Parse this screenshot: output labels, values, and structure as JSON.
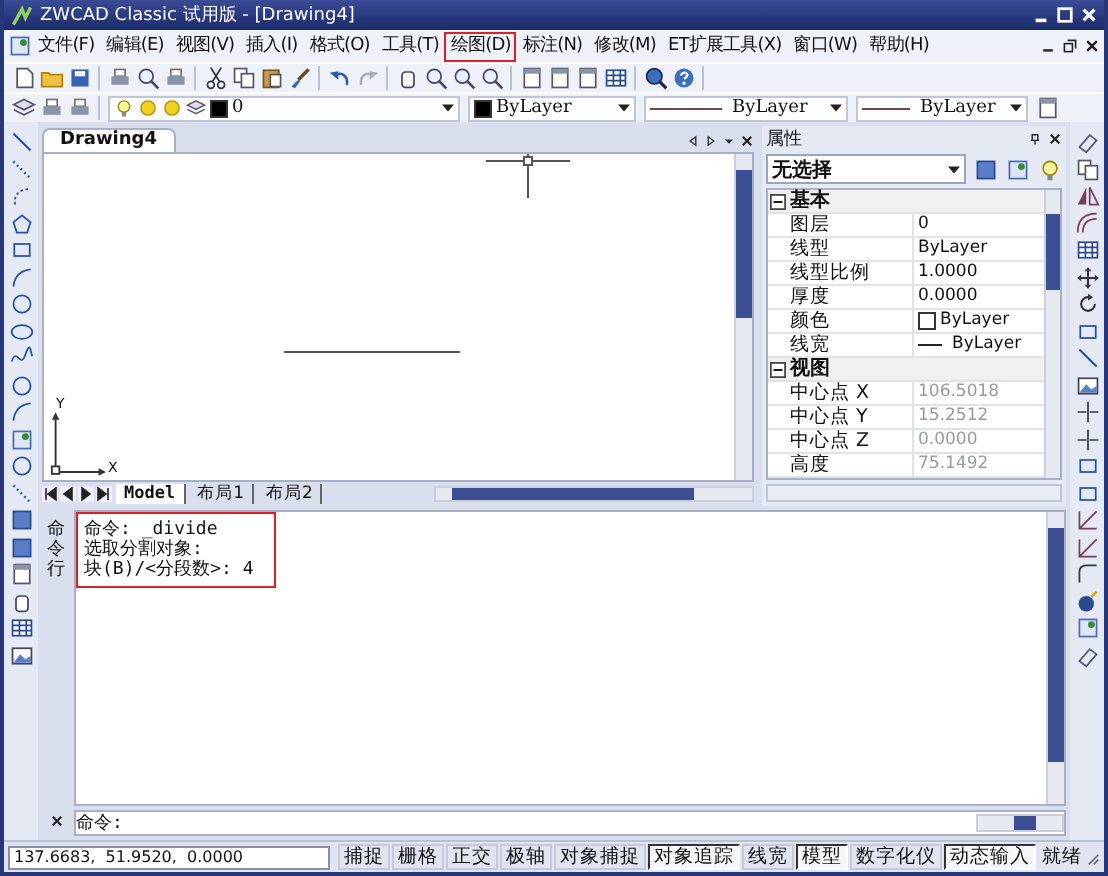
{
  "window": {
    "title": "ZWCAD Classic 试用版 - [Drawing4]"
  },
  "menu": [
    {
      "label": "文件(F)",
      "highlighted": false
    },
    {
      "label": "编辑(E)",
      "highlighted": false
    },
    {
      "label": "视图(V)",
      "highlighted": false
    },
    {
      "label": "插入(I)",
      "highlighted": false
    },
    {
      "label": "格式(O)",
      "highlighted": false
    },
    {
      "label": "工具(T)",
      "highlighted": false
    },
    {
      "label": "绘图(D)",
      "highlighted": true
    },
    {
      "label": "标注(N)",
      "highlighted": false
    },
    {
      "label": "修改(M)",
      "highlighted": false
    },
    {
      "label": "ET扩展工具(X)",
      "highlighted": false
    },
    {
      "label": "窗口(W)",
      "highlighted": false
    },
    {
      "label": "帮助(H)",
      "highlighted": false
    }
  ],
  "layer_toolbar": {
    "layer": "0",
    "color_setting": "ByLayer",
    "linetype": "ByLayer",
    "lineweight": "ByLayer"
  },
  "document": {
    "tab": "Drawing4",
    "y_label": "Y",
    "x_label": "X",
    "layout_tabs": [
      {
        "label": "Model",
        "selected": true
      },
      {
        "label": "布局1",
        "selected": false
      },
      {
        "label": "布局2",
        "selected": false
      }
    ]
  },
  "properties": {
    "title": "属性",
    "selection": "无选择",
    "groups": [
      {
        "name": "基本",
        "expanded": true,
        "rows": [
          {
            "label": "图层",
            "value": "0",
            "kind": "text",
            "disabled": false
          },
          {
            "label": "线型",
            "value": "ByLayer",
            "kind": "text",
            "disabled": false
          },
          {
            "label": "线型比例",
            "value": "1.0000",
            "kind": "text",
            "disabled": false
          },
          {
            "label": "厚度",
            "value": "0.0000",
            "kind": "text",
            "disabled": false
          },
          {
            "label": "颜色",
            "value": "ByLayer",
            "kind": "color",
            "disabled": false
          },
          {
            "label": "线宽",
            "value": "ByLayer",
            "kind": "lineweight",
            "disabled": false
          }
        ]
      },
      {
        "name": "视图",
        "expanded": true,
        "rows": [
          {
            "label": "中心点 X",
            "value": "106.5018",
            "kind": "text",
            "disabled": true
          },
          {
            "label": "中心点 Y",
            "value": "15.2512",
            "kind": "text",
            "disabled": true
          },
          {
            "label": "中心点 Z",
            "value": "0.0000",
            "kind": "text",
            "disabled": true
          },
          {
            "label": "高度",
            "value": "75.1492",
            "kind": "text",
            "disabled": true
          }
        ]
      }
    ]
  },
  "command": {
    "side_label": "命令行",
    "highlighted": true,
    "history": [
      "命令: _divide",
      "选取分割对象:",
      "块(B)/<分段数>: 4"
    ],
    "prompt": "命令:"
  },
  "status_bar": {
    "coordinates": "137.6683,  51.9520,  0.0000",
    "buttons": [
      {
        "label": "捕捉",
        "on": false
      },
      {
        "label": "栅格",
        "on": false
      },
      {
        "label": "正交",
        "on": false
      },
      {
        "label": "极轴",
        "on": false
      },
      {
        "label": "对象捕捉",
        "on": false
      },
      {
        "label": "对象追踪",
        "on": true
      },
      {
        "label": "线宽",
        "on": false
      },
      {
        "label": "模型",
        "on": true
      },
      {
        "label": "数字化仪",
        "on": false
      },
      {
        "label": "动态输入",
        "on": true
      }
    ],
    "state": "就绪"
  }
}
